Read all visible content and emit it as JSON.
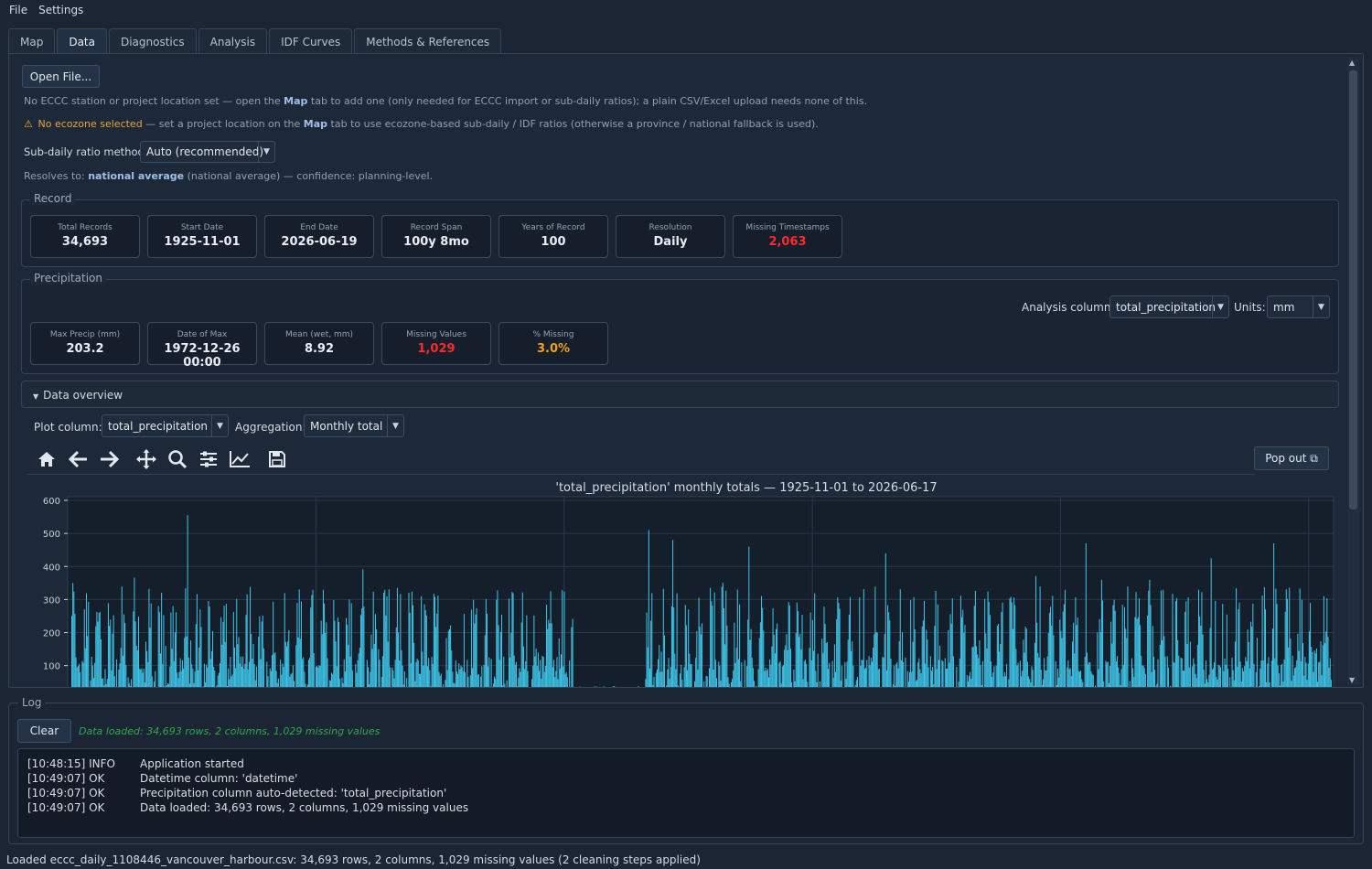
{
  "menu": [
    "File",
    "Settings"
  ],
  "tabs": [
    "Map",
    "Data",
    "Diagnostics",
    "Analysis",
    "IDF Curves",
    "Methods & References"
  ],
  "active_tab": "Data",
  "open_file_label": "Open File...",
  "station_note": {
    "part1": "No ECCC station or project location set — open the ",
    "map": "Map",
    "part2": " tab to add one (only needed for ECCC import or sub-daily ratios); a plain CSV/Excel upload needs none of this."
  },
  "ecozone_note": {
    "warn": "No ecozone selected",
    "part1": " — set a project location on the ",
    "map": "Map",
    "part2": " tab to use ecozone-based sub-daily / IDF ratios (otherwise a province / national fallback is used)."
  },
  "ratio_method": {
    "label": "Sub-daily ratio method:",
    "value": "Auto (recommended)"
  },
  "resolves": {
    "prefix": "Resolves to: ",
    "value": "national average",
    "suffix": " (national average) — confidence: planning-level."
  },
  "record": {
    "title": "Record",
    "cards": [
      {
        "label": "Total Records",
        "value": "34,693",
        "tone": "normal"
      },
      {
        "label": "Start Date",
        "value": "1925-11-01",
        "tone": "normal"
      },
      {
        "label": "End Date",
        "value": "2026-06-19",
        "tone": "normal"
      },
      {
        "label": "Record Span",
        "value": "100y 8mo",
        "tone": "normal"
      },
      {
        "label": "Years of Record",
        "value": "100",
        "tone": "normal"
      },
      {
        "label": "Resolution",
        "value": "Daily",
        "tone": "normal"
      },
      {
        "label": "Missing Timestamps",
        "value": "2,063",
        "tone": "red"
      }
    ]
  },
  "precip": {
    "title": "Precipitation",
    "analysis_label": "Analysis column:",
    "analysis_value": "total_precipitation",
    "units_label": "Units:",
    "units_value": "mm",
    "cards": [
      {
        "label": "Max Precip (mm)",
        "value": "203.2",
        "tone": "normal"
      },
      {
        "label": "Date of Max",
        "value": "1972-12-26 00:00",
        "tone": "normal"
      },
      {
        "label": "Mean (wet, mm)",
        "value": "8.92",
        "tone": "normal"
      },
      {
        "label": "Missing Values",
        "value": "1,029",
        "tone": "red"
      },
      {
        "label": "% Missing",
        "value": "3.0%",
        "tone": "orange"
      }
    ]
  },
  "overview": {
    "title": "Data overview",
    "plot_label": "Plot column:",
    "plot_value": "total_precipitation",
    "agg_label": "Aggregation:",
    "agg_value": "Monthly total",
    "popout_label": "Pop out ⧉"
  },
  "toolbar_icons": [
    "home-icon",
    "back-arrow-icon",
    "forward-arrow-icon",
    "pan-icon",
    "zoom-icon",
    "subplots-config-icon",
    "edit-axis-icon",
    "save-icon"
  ],
  "chart_data": {
    "type": "bar",
    "title": "'total_precipitation' monthly totals — 1925-11-01 to 2026-06-17",
    "xlabel": "",
    "ylabel": "",
    "ylim": [
      0,
      600
    ],
    "yticks": [
      100,
      200,
      300,
      400,
      500,
      600
    ],
    "visible_ylim": [
      50,
      600
    ],
    "grid": true,
    "color": "#3ec3e6",
    "start": "1925-11",
    "note": "monthly totals, one bar per month (approx. 1208 months); values estimated",
    "peaks": [
      {
        "month": "1935-02",
        "value": 555
      },
      {
        "month": "1971-12",
        "value": 510
      },
      {
        "month": "1973-11",
        "value": 480
      },
      {
        "month": "1979-12",
        "value": 460
      },
      {
        "month": "1990-11",
        "value": 440
      },
      {
        "month": "2006-11",
        "value": 470
      },
      {
        "month": "2016-11",
        "value": 425
      },
      {
        "month": "2021-11",
        "value": 470
      },
      {
        "month": "1925-12",
        "value": 350
      }
    ]
  },
  "log": {
    "title": "Log",
    "clear_label": "Clear",
    "status_line": "Data loaded: 34,693 rows, 2 columns, 1,029 missing values",
    "entries": [
      {
        "time": "[10:48:15]",
        "level": "INFO",
        "msg": "Application started"
      },
      {
        "time": "[10:49:07]",
        "level": "OK",
        "msg": "Datetime column: 'datetime'"
      },
      {
        "time": "[10:49:07]",
        "level": "OK",
        "msg": "Precipitation column auto-detected: 'total_precipitation'"
      },
      {
        "time": "[10:49:07]",
        "level": "OK",
        "msg": "Data loaded: 34,693 rows, 2 columns, 1,029 missing values"
      }
    ]
  },
  "statusbar": "Loaded eccc_daily_1108446_vancouver_harbour.csv: 34,693 rows, 2 columns, 1,029 missing values  (2 cleaning steps applied)"
}
